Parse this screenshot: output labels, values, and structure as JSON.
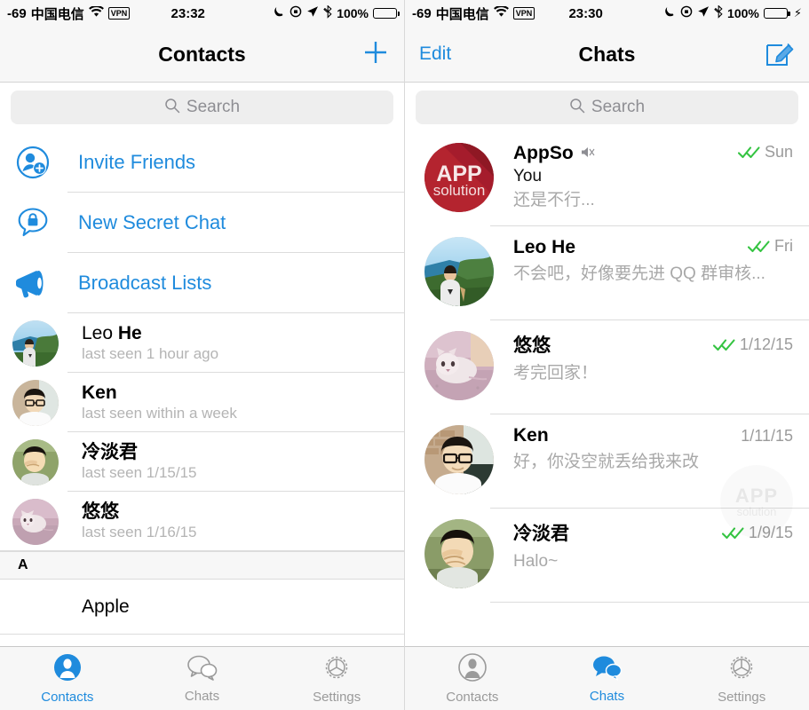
{
  "left": {
    "status": {
      "signal": "-69",
      "carrier": "中国电信",
      "wifi_icon": "wifi-icon",
      "vpn": "VPN",
      "time": "23:32",
      "moon_icon": "moon-icon",
      "lock_icon": "rotation-lock-icon",
      "location_icon": "location-arrow-icon",
      "bluetooth_icon": "bluetooth-icon",
      "battery_pct": "100%",
      "battery_state": "full"
    },
    "nav": {
      "title": "Contacts",
      "right_action": "add-contact"
    },
    "search": {
      "placeholder": "Search",
      "value": ""
    },
    "actions": [
      {
        "label": "Invite Friends",
        "icon": "add-person-icon"
      },
      {
        "label": "New Secret Chat",
        "icon": "secret-chat-lock-icon"
      },
      {
        "label": "Broadcast Lists",
        "icon": "megaphone-icon"
      }
    ],
    "contacts": [
      {
        "first": "Leo",
        "last": "He",
        "sub": "last seen 1 hour ago",
        "avatar": "leo"
      },
      {
        "first": "",
        "last": "Ken",
        "sub": "last seen within a week",
        "avatar": "ken"
      },
      {
        "first": "",
        "last": "冷淡君",
        "sub": "last seen 1/15/15",
        "avatar": "leng"
      },
      {
        "first": "",
        "last": "悠悠",
        "sub": "last seen 1/16/15",
        "avatar": "cat"
      }
    ],
    "section_header": "A",
    "section_rows": [
      {
        "name": "Apple"
      }
    ],
    "tabs": [
      {
        "label": "Contacts",
        "icon": "person-icon",
        "active": true
      },
      {
        "label": "Chats",
        "icon": "chat-bubbles-icon",
        "active": false
      },
      {
        "label": "Settings",
        "icon": "gear-icon",
        "active": false
      }
    ]
  },
  "right": {
    "status": {
      "signal": "-69",
      "carrier": "中国电信",
      "wifi_icon": "wifi-icon",
      "vpn": "VPN",
      "time": "23:30",
      "moon_icon": "moon-icon",
      "lock_icon": "rotation-lock-icon",
      "location_icon": "location-arrow-icon",
      "bluetooth_icon": "bluetooth-icon",
      "battery_pct": "100%",
      "battery_state": "charging"
    },
    "nav": {
      "left_label": "Edit",
      "title": "Chats",
      "right_action": "compose"
    },
    "search": {
      "placeholder": "Search",
      "value": ""
    },
    "chats": [
      {
        "name": "AppSo",
        "muted": true,
        "sender": "You",
        "message": "还是不行...",
        "date": "Sun",
        "ticks": "double",
        "avatar": "appso"
      },
      {
        "name": "Leo He",
        "muted": false,
        "sender": "",
        "message": "不会吧，好像要先进 QQ 群审核...",
        "date": "Fri",
        "ticks": "double",
        "avatar": "leo"
      },
      {
        "name": "悠悠",
        "muted": false,
        "sender": "",
        "message": "考完回家！",
        "date": "1/12/15",
        "ticks": "double",
        "avatar": "cat"
      },
      {
        "name": "Ken",
        "muted": false,
        "sender": "",
        "message": "好，你没空就丢给我来改",
        "date": "1/11/15",
        "ticks": "none",
        "avatar": "ken"
      },
      {
        "name": "冷淡君",
        "muted": false,
        "sender": "",
        "message": "Halo~",
        "date": "1/9/15",
        "ticks": "double",
        "avatar": "leng"
      }
    ],
    "watermark": {
      "line1": "APP",
      "line2": "solution"
    },
    "tabs": [
      {
        "label": "Contacts",
        "icon": "person-icon",
        "active": false
      },
      {
        "label": "Chats",
        "icon": "chat-bubbles-icon",
        "active": true
      },
      {
        "label": "Settings",
        "icon": "gear-icon",
        "active": false
      }
    ]
  },
  "colors": {
    "accent": "#1f8bdd",
    "tick_green": "#35c442",
    "subtle_text": "#b4b4b4",
    "bar_bg": "#f7f7f7",
    "appso_red": "#b02030"
  }
}
